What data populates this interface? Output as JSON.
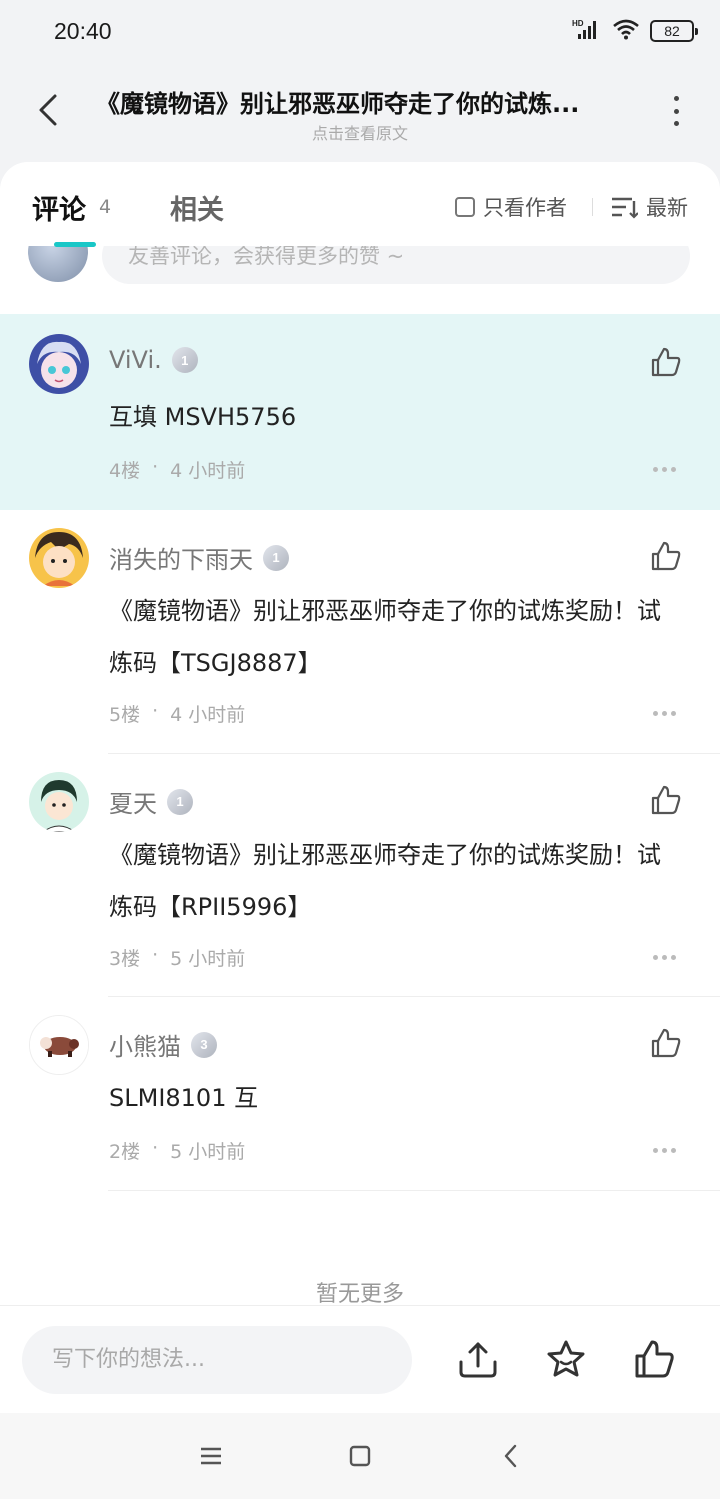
{
  "status_bar": {
    "time": "20:40",
    "battery": "82",
    "network": "HD"
  },
  "header": {
    "title": "《魔镜物语》别让邪恶巫师夺走了你的试炼...",
    "subtitle": "点击查看原文"
  },
  "tabs": {
    "comments_label": "评论",
    "comments_count": "4",
    "related_label": "相关",
    "author_only_label": "只看作者",
    "sort_label": "最新"
  },
  "compose_top": {
    "placeholder": "友善评论，会获得更多的赞 ~"
  },
  "comments": [
    {
      "username": "ViVi.",
      "level": "1",
      "text_line1": "互填  MSVH5756",
      "text_line2": "",
      "floor": "4楼",
      "time": "4 小时前",
      "highlighted": true
    },
    {
      "username": "消失的下雨天",
      "level": "1",
      "text_line1": "《魔镜物语》别让邪恶巫师夺走了你的试炼奖励！试",
      "text_line2": "炼码【TSGJ8887】",
      "floor": "5楼",
      "time": "4 小时前",
      "highlighted": false
    },
    {
      "username": "夏天",
      "level": "1",
      "text_line1": "《魔镜物语》别让邪恶巫师夺走了你的试炼奖励！试",
      "text_line2": "炼码【RPII5996】",
      "floor": "3楼",
      "time": "5 小时前",
      "highlighted": false
    },
    {
      "username": "小熊猫",
      "level": "3",
      "text_line1": "SLMI8101 互",
      "text_line2": "",
      "floor": "2楼",
      "time": "5 小时前",
      "highlighted": false
    }
  ],
  "meta_separator": "·",
  "footer_text": "暂无更多",
  "bottom_bar": {
    "input_placeholder": "写下你的想法..."
  },
  "colors": {
    "accent": "#19c7c7",
    "highlight_bg": "#e4f6f6"
  },
  "icons": [
    "back-arrow-icon",
    "more-vertical-icon",
    "checkbox-icon",
    "sort-icon",
    "thumbs-up-icon",
    "share-icon",
    "star-icon",
    "menu-icon",
    "home-square-icon",
    "nav-back-icon"
  ]
}
